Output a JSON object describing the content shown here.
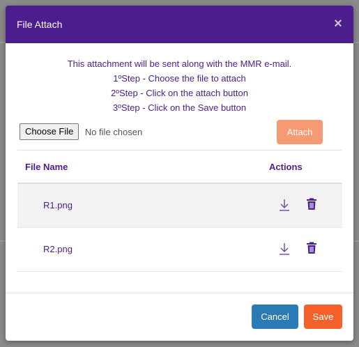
{
  "modal": {
    "title": "File Attach",
    "close_glyph": "×"
  },
  "instructions": [
    "This attachment will be sent along with the MMR e-mail.",
    "1ºStep - Choose the file to attach",
    "2ºStep - Click on the attach button",
    "3ºStep - Click on the Save button"
  ],
  "file_input": {
    "button_label": "Choose File",
    "status_text": "No file chosen"
  },
  "attach_button_label": "Attach",
  "table": {
    "headers": {
      "name": "File Name",
      "actions": "Actions"
    },
    "rows": [
      {
        "name": "R1.png",
        "actions": [
          "download-icon",
          "trash-icon"
        ]
      },
      {
        "name": "R2.png",
        "actions": [
          "download-icon",
          "trash-icon"
        ]
      }
    ]
  },
  "footer": {
    "cancel_label": "Cancel",
    "save_label": "Save"
  },
  "colors": {
    "header_bg": "#4c1d8c",
    "accent_text": "#4c1d8c",
    "attach_button": "#f59a72",
    "cancel_button": "#2a7ab5",
    "save_button": "#f5612a"
  }
}
